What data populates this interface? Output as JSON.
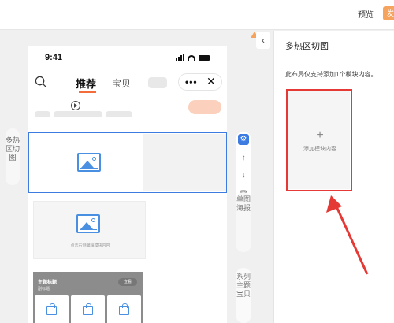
{
  "topbar": {
    "preview_label": "预览",
    "publish_label": "发布",
    "accent_color": "#f5a35d"
  },
  "phone": {
    "time": "9:41",
    "tabs": [
      {
        "label": "推荐",
        "active": true
      },
      {
        "label": "宝贝",
        "active": false
      }
    ],
    "capsule": {
      "more_icon": "more-dots-icon",
      "close_icon": "close-icon",
      "more": "•••",
      "close": "✕"
    }
  },
  "canvas": {
    "left_label": "多热区切图",
    "poster_placeholder": "点击右侧编辑模块内容",
    "series_title": "主题标题",
    "series_subtitle": "副标题",
    "series_more": "查看",
    "right_labels": [
      "单图海报",
      "系列主题宝贝"
    ],
    "selection_color": "#3d7be0"
  },
  "tools": {
    "settings_icon": "gear-icon",
    "up_icon": "arrow-up-icon",
    "down_icon": "arrow-down-icon",
    "delete_icon": "trash-icon"
  },
  "panel": {
    "title": "多热区切图",
    "description": "此布局仅支持添加1个模块内容。",
    "add_plus": "+",
    "add_label": "添加模块内容",
    "highlight_color": "#e53935"
  }
}
